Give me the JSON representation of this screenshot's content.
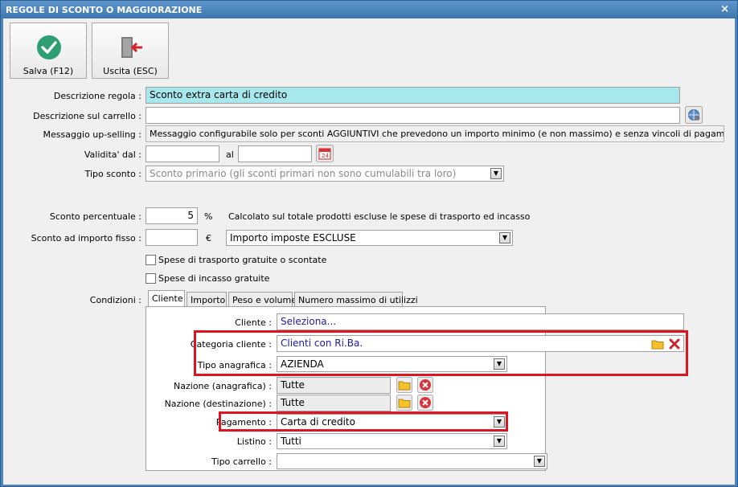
{
  "window": {
    "title": "REGOLE DI SCONTO O MAGGIORAZIONE",
    "close_glyph": "×"
  },
  "toolbar": {
    "save_label": "Salva (F12)",
    "exit_label": "Uscita (ESC)",
    "save_icon": "check-circle-icon",
    "exit_icon": "exit-door-icon"
  },
  "form": {
    "descrizione_regola_label": "Descrizione regola :",
    "descrizione_regola_value": "Sconto extra carta di credito",
    "descrizione_carrello_label": "Descrizione sul carrello :",
    "descrizione_carrello_value": "",
    "messaggio_label": "Messaggio up-selling :",
    "messaggio_value": "Messaggio configurabile solo per sconti AGGIUNTIVI che prevedono un importo minimo (e non massimo) e senza vincoli di pagamento, peso o volume",
    "validita_label": "Validita' dal :",
    "validita_from": "",
    "al_label": "al",
    "validita_to": "",
    "calendar_icon_text": "24",
    "tipo_sconto_label": "Tipo sconto :",
    "tipo_sconto_value": "Sconto primario (gli sconti primari non sono cumulabili tra loro)",
    "sconto_perc_label": "Sconto percentuale :",
    "sconto_perc_value": "5",
    "perc_symbol": "%",
    "sconto_perc_note": "Calcolato sul totale prodotti escluse le spese di trasporto ed incasso",
    "sconto_fisso_label": "Sconto ad importo fisso :",
    "sconto_fisso_value": "",
    "euro_symbol": "€",
    "imposte_value": "Importo imposte ESCLUSE",
    "spese_trasporto_label": "Spese di trasporto gratuite o scontate",
    "spese_incasso_label": "Spese di incasso gratuite",
    "condizioni_label": "Condizioni :"
  },
  "tabs": [
    {
      "label": "Cliente"
    },
    {
      "label": "Importo"
    },
    {
      "label": "Peso e volume"
    },
    {
      "label": "Numero massimo di utilizzi"
    }
  ],
  "cliente_tab": {
    "cliente_label": "Cliente :",
    "cliente_value": "Seleziona...",
    "categoria_label": "Categoria cliente :",
    "categoria_value": "Clienti con Ri.Ba.",
    "tipo_anagrafica_label": "Tipo anagrafica :",
    "tipo_anagrafica_value": "AZIENDA",
    "nazione_anagrafica_label": "Nazione (anagrafica) :",
    "nazione_anagrafica_value": "Tutte",
    "nazione_destinazione_label": "Nazione (destinazione) :",
    "nazione_destinazione_value": "Tutte",
    "pagamento_label": "Pagamento :",
    "pagamento_value": "Carta di credito",
    "listino_label": "Listino :",
    "listino_value": "Tutti",
    "tipo_carrello_label": "Tipo carrello :",
    "tipo_carrello_value": ""
  },
  "colors": {
    "title_bar": "#4e86bd",
    "highlight_input": "#a6e8ec",
    "annotation_red": "#e0141e",
    "link_blue": "#1a1aa6"
  }
}
